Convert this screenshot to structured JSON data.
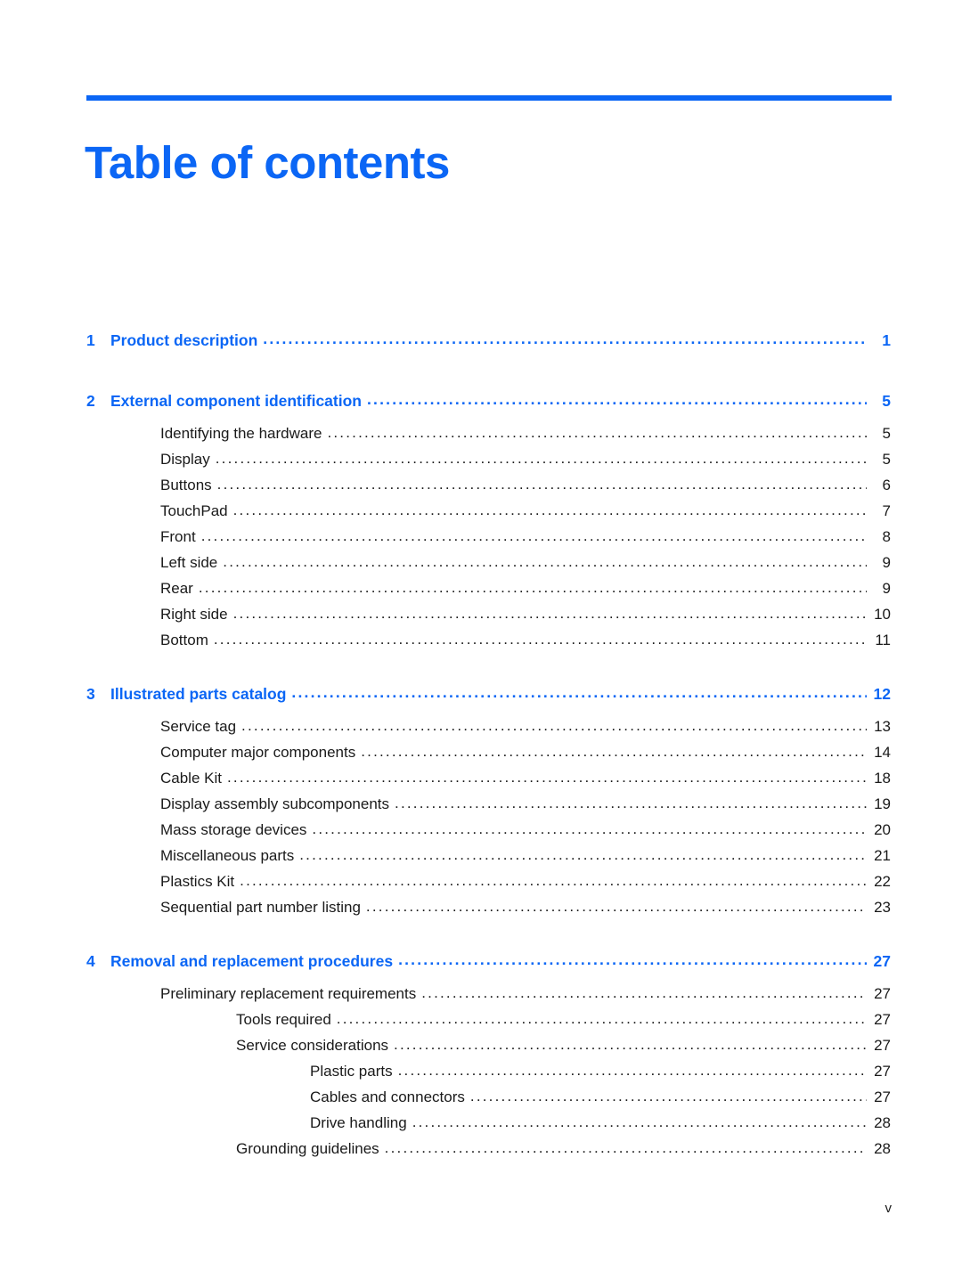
{
  "document": {
    "title": "Table of contents",
    "accent_color": "#0B66F5",
    "text_color": "#1a1a1a",
    "footer_page_label": "v"
  },
  "toc": {
    "entries": [
      {
        "level": 0,
        "number": "1",
        "label": "Product description",
        "page": "1"
      },
      {
        "level": 0,
        "number": "2",
        "label": "External component identification",
        "page": "5"
      },
      {
        "level": 1,
        "number": "",
        "label": "Identifying the hardware",
        "page": "5"
      },
      {
        "level": 1,
        "number": "",
        "label": "Display",
        "page": "5"
      },
      {
        "level": 1,
        "number": "",
        "label": "Buttons",
        "page": "6"
      },
      {
        "level": 1,
        "number": "",
        "label": "TouchPad",
        "page": "7"
      },
      {
        "level": 1,
        "number": "",
        "label": "Front",
        "page": "8"
      },
      {
        "level": 1,
        "number": "",
        "label": "Left side",
        "page": "9"
      },
      {
        "level": 1,
        "number": "",
        "label": "Rear",
        "page": "9"
      },
      {
        "level": 1,
        "number": "",
        "label": "Right side",
        "page": "10"
      },
      {
        "level": 1,
        "number": "",
        "label": "Bottom",
        "page": "11"
      },
      {
        "level": 0,
        "number": "3",
        "label": "Illustrated parts catalog",
        "page": "12"
      },
      {
        "level": 1,
        "number": "",
        "label": "Service tag",
        "page": "13"
      },
      {
        "level": 1,
        "number": "",
        "label": "Computer major components",
        "page": "14"
      },
      {
        "level": 1,
        "number": "",
        "label": "Cable Kit",
        "page": "18"
      },
      {
        "level": 1,
        "number": "",
        "label": "Display assembly subcomponents",
        "page": "19"
      },
      {
        "level": 1,
        "number": "",
        "label": "Mass storage devices",
        "page": "20"
      },
      {
        "level": 1,
        "number": "",
        "label": "Miscellaneous parts",
        "page": "21"
      },
      {
        "level": 1,
        "number": "",
        "label": "Plastics Kit",
        "page": "22"
      },
      {
        "level": 1,
        "number": "",
        "label": "Sequential part number listing",
        "page": "23"
      },
      {
        "level": 0,
        "number": "4",
        "label": "Removal and replacement procedures",
        "page": "27"
      },
      {
        "level": 1,
        "number": "",
        "label": "Preliminary replacement requirements",
        "page": "27"
      },
      {
        "level": 2,
        "number": "",
        "label": "Tools required",
        "page": "27"
      },
      {
        "level": 2,
        "number": "",
        "label": "Service considerations",
        "page": "27"
      },
      {
        "level": 3,
        "number": "",
        "label": "Plastic parts",
        "page": "27"
      },
      {
        "level": 3,
        "number": "",
        "label": "Cables and connectors",
        "page": "27"
      },
      {
        "level": 3,
        "number": "",
        "label": "Drive handling",
        "page": "28"
      },
      {
        "level": 2,
        "number": "",
        "label": "Grounding guidelines",
        "page": "28"
      }
    ]
  }
}
